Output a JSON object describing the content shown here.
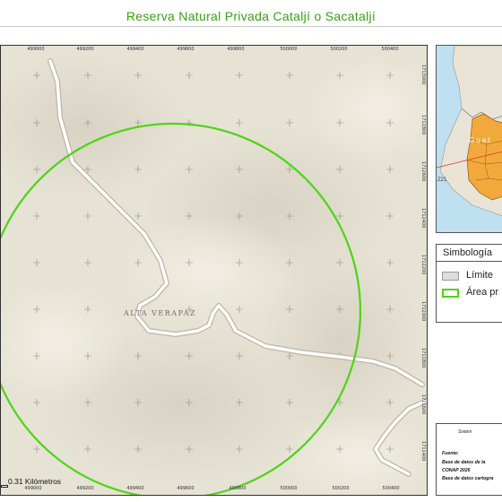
{
  "title": "Reserva Natural Privada Cataljí o Sacataljí",
  "map": {
    "region_label": "ALTA VERAPAZ",
    "easting_labels_top": [
      "499000",
      "499200",
      "499400",
      "499600",
      "499800",
      "500000",
      "500200",
      "500400"
    ],
    "easting_labels_bottom": [
      "499000",
      "499200",
      "499400",
      "499600",
      "499800",
      "500000",
      "500200",
      "500400"
    ],
    "northing_labels": [
      "1713000",
      "1712800",
      "1712600",
      "1712400",
      "1712200",
      "1712000",
      "1711800",
      "1711600",
      "1711400",
      "1711200"
    ],
    "scale_label": "0.31 Kilómetros",
    "colors": {
      "terrain": "#e6e2d4",
      "road": "#ffffff",
      "road_casing": "#bdb6a6",
      "reserve_outline": "#4fd418"
    }
  },
  "inset": {
    "label_country": "Guat",
    "label_zone": "Z21",
    "colors": {
      "sea": "#bfe0f0",
      "land": "#e9e4d6",
      "region": "#f2a93b",
      "pointer": "#d93030"
    }
  },
  "legend": {
    "title": "Simbología",
    "items": [
      {
        "label": "Límite",
        "fill": "#dddddd",
        "stroke": "#999999"
      },
      {
        "label": "Área pr",
        "fill": "#ffffff",
        "stroke": "#4fd418"
      }
    ]
  },
  "source": {
    "sistema": "Sistem",
    "fuente": "Fuente:",
    "line1": "Base de datos de la",
    "line2": "CONAP 2026",
    "line3": "Base de datos cartogra"
  }
}
